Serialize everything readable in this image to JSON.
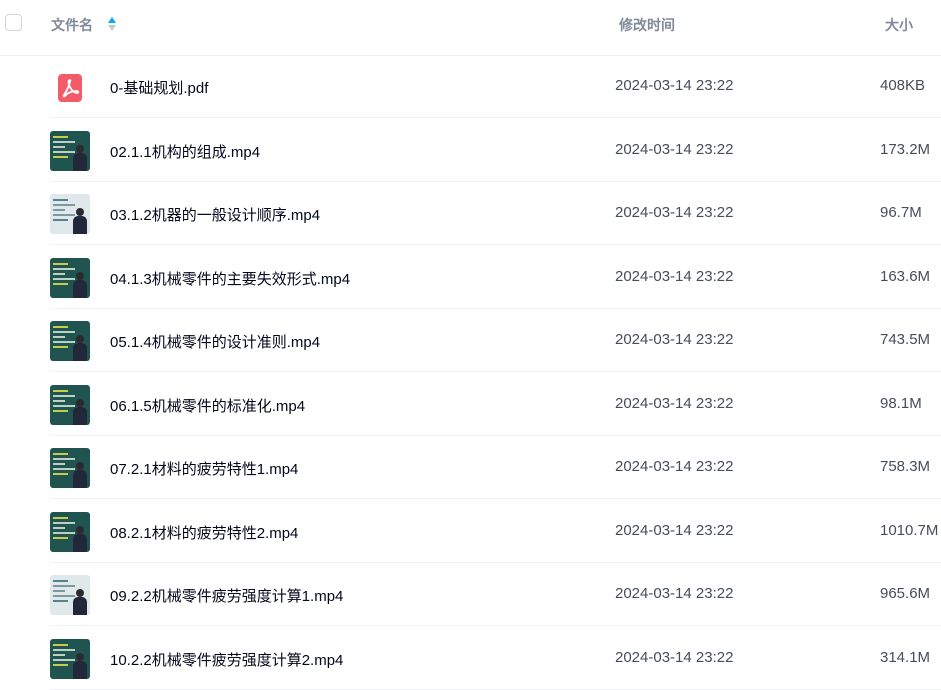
{
  "header": {
    "name_label": "文件名",
    "time_label": "修改时间",
    "size_label": "大小",
    "sort_icon": "sort-ascending-icon"
  },
  "files": [
    {
      "name": "0-基础规划.pdf",
      "time": "2024-03-14 23:22",
      "size": "408KB",
      "type": "pdf",
      "icon": "pdf-icon"
    },
    {
      "name": "02.1.1机构的组成.mp4",
      "time": "2024-03-14 23:22",
      "size": "173.2M",
      "type": "video",
      "icon": "video-thumbnail"
    },
    {
      "name": "03.1.2机器的一般设计顺序.mp4",
      "time": "2024-03-14 23:22",
      "size": "96.7M",
      "type": "video",
      "icon": "video-thumbnail"
    },
    {
      "name": "04.1.3机械零件的主要失效形式.mp4",
      "time": "2024-03-14 23:22",
      "size": "163.6M",
      "type": "video",
      "icon": "video-thumbnail"
    },
    {
      "name": "05.1.4机械零件的设计准则.mp4",
      "time": "2024-03-14 23:22",
      "size": "743.5M",
      "type": "video",
      "icon": "video-thumbnail"
    },
    {
      "name": "06.1.5机械零件的标准化.mp4",
      "time": "2024-03-14 23:22",
      "size": "98.1M",
      "type": "video",
      "icon": "video-thumbnail"
    },
    {
      "name": "07.2.1材料的疲劳特性1.mp4",
      "time": "2024-03-14 23:22",
      "size": "758.3M",
      "type": "video",
      "icon": "video-thumbnail"
    },
    {
      "name": "08.2.1材料的疲劳特性2.mp4",
      "time": "2024-03-14 23:22",
      "size": "1010.7M",
      "type": "video",
      "icon": "video-thumbnail"
    },
    {
      "name": "09.2.2机械零件疲劳强度计算1.mp4",
      "time": "2024-03-14 23:22",
      "size": "965.6M",
      "type": "video",
      "icon": "video-thumbnail"
    },
    {
      "name": "10.2.2机械零件疲劳强度计算2.mp4",
      "time": "2024-03-14 23:22",
      "size": "314.1M",
      "type": "video",
      "icon": "video-thumbnail"
    }
  ],
  "colors": {
    "pdf_icon": "#f35b67",
    "header_text": "#818999",
    "name_text": "#03081a",
    "meta_text": "#454d5a",
    "sort_up": "#06a7ff",
    "sort_down": "#c4c9d1"
  }
}
